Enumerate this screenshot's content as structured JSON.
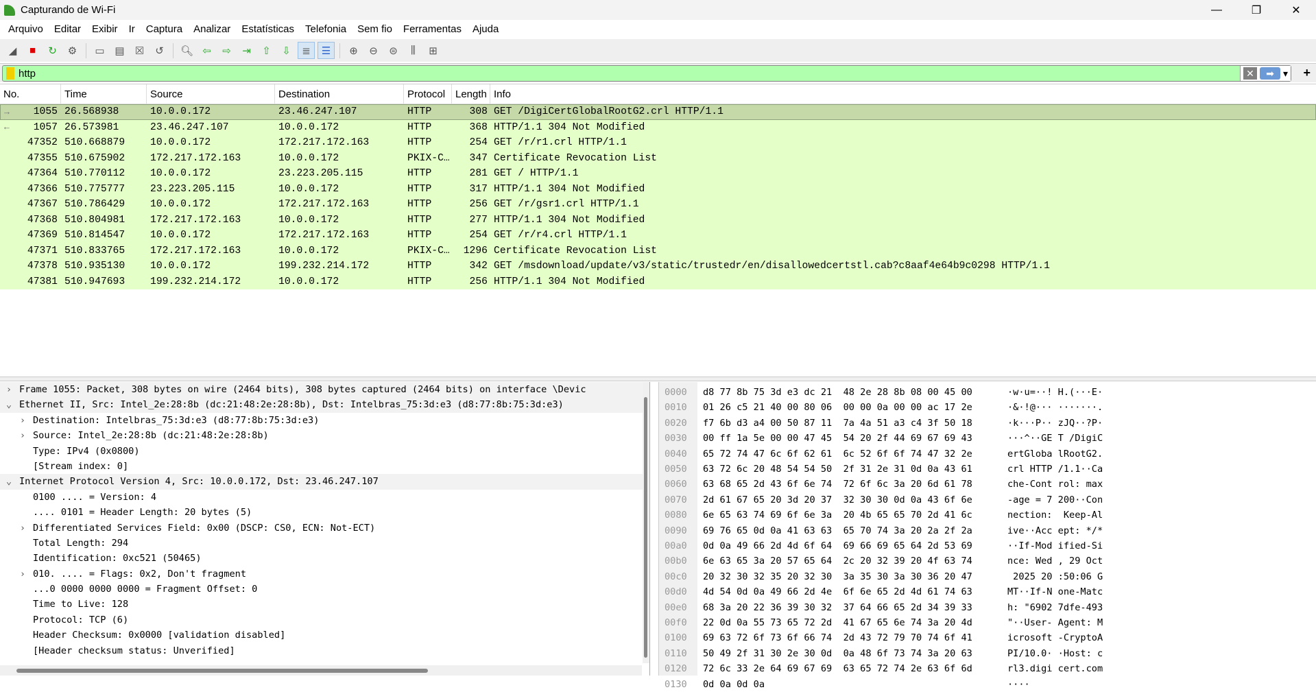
{
  "window": {
    "title": "Capturando de Wi-Fi",
    "minimize": "—",
    "restore": "❐",
    "close": "✕"
  },
  "menu": [
    "Arquivo",
    "Editar",
    "Exibir",
    "Ir",
    "Captura",
    "Analizar",
    "Estatísticas",
    "Telefonia",
    "Sem fio",
    "Ferramentas",
    "Ajuda"
  ],
  "toolbar_icons": [
    "start-capture-icon",
    "stop-capture-icon",
    "restart-capture-icon",
    "capture-options-icon",
    "open-file-icon",
    "save-file-icon",
    "close-file-icon",
    "reload-file-icon",
    "find-packet-icon",
    "go-back-icon",
    "go-forward-icon",
    "go-to-packet-icon",
    "first-packet-icon",
    "last-packet-icon",
    "autoscroll-icon",
    "colorize-icon",
    "zoom-in-icon",
    "zoom-out-icon",
    "normal-size-icon",
    "resize-columns-icon",
    "layout-icon"
  ],
  "filter": {
    "value": "http",
    "clear": "✕",
    "apply": "➡",
    "dropdown": "▾",
    "add": "+"
  },
  "packet_list": {
    "columns": [
      "No.",
      "Time",
      "Source",
      "Destination",
      "Protocol",
      "Length",
      "Info"
    ],
    "rows": [
      {
        "no": "1055",
        "time": "26.568938",
        "src": "10.0.0.172",
        "dst": "23.46.247.107",
        "proto": "HTTP",
        "len": "308",
        "info": "GET /DigiCertGlobalRootG2.crl HTTP/1.1",
        "selected": true,
        "mark": "→"
      },
      {
        "no": "1057",
        "time": "26.573981",
        "src": "23.46.247.107",
        "dst": "10.0.0.172",
        "proto": "HTTP",
        "len": "368",
        "info": "HTTP/1.1 304 Not Modified",
        "mark": "←"
      },
      {
        "no": "47352",
        "time": "510.668879",
        "src": "10.0.0.172",
        "dst": "172.217.172.163",
        "proto": "HTTP",
        "len": "254",
        "info": "GET /r/r1.crl HTTP/1.1"
      },
      {
        "no": "47355",
        "time": "510.675902",
        "src": "172.217.172.163",
        "dst": "10.0.0.172",
        "proto": "PKIX-C…",
        "len": "347",
        "info": "Certificate Revocation List"
      },
      {
        "no": "47364",
        "time": "510.770112",
        "src": "10.0.0.172",
        "dst": "23.223.205.115",
        "proto": "HTTP",
        "len": "281",
        "info": "GET / HTTP/1.1"
      },
      {
        "no": "47366",
        "time": "510.775777",
        "src": "23.223.205.115",
        "dst": "10.0.0.172",
        "proto": "HTTP",
        "len": "317",
        "info": "HTTP/1.1 304 Not Modified"
      },
      {
        "no": "47367",
        "time": "510.786429",
        "src": "10.0.0.172",
        "dst": "172.217.172.163",
        "proto": "HTTP",
        "len": "256",
        "info": "GET /r/gsr1.crl HTTP/1.1"
      },
      {
        "no": "47368",
        "time": "510.804981",
        "src": "172.217.172.163",
        "dst": "10.0.0.172",
        "proto": "HTTP",
        "len": "277",
        "info": "HTTP/1.1 304 Not Modified"
      },
      {
        "no": "47369",
        "time": "510.814547",
        "src": "10.0.0.172",
        "dst": "172.217.172.163",
        "proto": "HTTP",
        "len": "254",
        "info": "GET /r/r4.crl HTTP/1.1"
      },
      {
        "no": "47371",
        "time": "510.833765",
        "src": "172.217.172.163",
        "dst": "10.0.0.172",
        "proto": "PKIX-C…",
        "len": "1296",
        "info": "Certificate Revocation List"
      },
      {
        "no": "47378",
        "time": "510.935130",
        "src": "10.0.0.172",
        "dst": "199.232.214.172",
        "proto": "HTTP",
        "len": "342",
        "info": "GET /msdownload/update/v3/static/trustedr/en/disallowedcertstl.cab?c8aaf4e64b9c0298 HTTP/1.1"
      },
      {
        "no": "47381",
        "time": "510.947693",
        "src": "199.232.214.172",
        "dst": "10.0.0.172",
        "proto": "HTTP",
        "len": "256",
        "info": "HTTP/1.1 304 Not Modified"
      }
    ]
  },
  "details": [
    {
      "level": 0,
      "exp": ">",
      "text": "Frame 1055: Packet, 308 bytes on wire (2464 bits), 308 bytes captured (2464 bits) on interface \\Devic"
    },
    {
      "level": 0,
      "exp": "v",
      "text": "Ethernet II, Src: Intel_2e:28:8b (dc:21:48:2e:28:8b), Dst: Intelbras_75:3d:e3 (d8:77:8b:75:3d:e3)"
    },
    {
      "level": 1,
      "exp": ">",
      "text": "Destination: Intelbras_75:3d:e3 (d8:77:8b:75:3d:e3)"
    },
    {
      "level": 1,
      "exp": ">",
      "text": "Source: Intel_2e:28:8b (dc:21:48:2e:28:8b)"
    },
    {
      "level": 1,
      "exp": "",
      "text": "Type: IPv4 (0x0800)"
    },
    {
      "level": 1,
      "exp": "",
      "text": "[Stream index: 0]"
    },
    {
      "level": 0,
      "exp": "v",
      "text": "Internet Protocol Version 4, Src: 10.0.0.172, Dst: 23.46.247.107"
    },
    {
      "level": 1,
      "exp": "",
      "text": "0100 .... = Version: 4"
    },
    {
      "level": 1,
      "exp": "",
      "text": ".... 0101 = Header Length: 20 bytes (5)"
    },
    {
      "level": 1,
      "exp": ">",
      "text": "Differentiated Services Field: 0x00 (DSCP: CS0, ECN: Not-ECT)"
    },
    {
      "level": 1,
      "exp": "",
      "text": "Total Length: 294"
    },
    {
      "level": 1,
      "exp": "",
      "text": "Identification: 0xc521 (50465)"
    },
    {
      "level": 1,
      "exp": ">",
      "text": "010. .... = Flags: 0x2, Don't fragment"
    },
    {
      "level": 1,
      "exp": "",
      "text": "...0 0000 0000 0000 = Fragment Offset: 0"
    },
    {
      "level": 1,
      "exp": "",
      "text": "Time to Live: 128"
    },
    {
      "level": 1,
      "exp": "",
      "text": "Protocol: TCP (6)"
    },
    {
      "level": 1,
      "exp": "",
      "text": "Header Checksum: 0x0000 [validation disabled]"
    },
    {
      "level": 1,
      "exp": "",
      "text": "[Header checksum status: Unverified]"
    }
  ],
  "bytes": [
    [
      "0000",
      "d8 77 8b 75 3d e3 dc 21  48 2e 28 8b 08 00 45 00",
      "·w·u=··! H.(···E·"
    ],
    [
      "0010",
      "01 26 c5 21 40 00 80 06  00 00 0a 00 00 ac 17 2e",
      "·&·!@··· ·······."
    ],
    [
      "0020",
      "f7 6b d3 a4 00 50 87 11  7a 4a 51 a3 c4 3f 50 18",
      "·k···P·· zJQ··?P·"
    ],
    [
      "0030",
      "00 ff 1a 5e 00 00 47 45  54 20 2f 44 69 67 69 43",
      "···^··GE T /DigiC"
    ],
    [
      "0040",
      "65 72 74 47 6c 6f 62 61  6c 52 6f 6f 74 47 32 2e",
      "ertGloba lRootG2."
    ],
    [
      "0050",
      "63 72 6c 20 48 54 54 50  2f 31 2e 31 0d 0a 43 61",
      "crl HTTP /1.1··Ca"
    ],
    [
      "0060",
      "63 68 65 2d 43 6f 6e 74  72 6f 6c 3a 20 6d 61 78",
      "che-Cont rol: max"
    ],
    [
      "0070",
      "2d 61 67 65 20 3d 20 37  32 30 30 0d 0a 43 6f 6e",
      "-age = 7 200··Con"
    ],
    [
      "0080",
      "6e 65 63 74 69 6f 6e 3a  20 4b 65 65 70 2d 41 6c",
      "nection:  Keep-Al"
    ],
    [
      "0090",
      "69 76 65 0d 0a 41 63 63  65 70 74 3a 20 2a 2f 2a",
      "ive··Acc ept: */*"
    ],
    [
      "00a0",
      "0d 0a 49 66 2d 4d 6f 64  69 66 69 65 64 2d 53 69",
      "··If-Mod ified-Si"
    ],
    [
      "00b0",
      "6e 63 65 3a 20 57 65 64  2c 20 32 39 20 4f 63 74",
      "nce: Wed , 29 Oct"
    ],
    [
      "00c0",
      "20 32 30 32 35 20 32 30  3a 35 30 3a 30 36 20 47",
      " 2025 20 :50:06 G"
    ],
    [
      "00d0",
      "4d 54 0d 0a 49 66 2d 4e  6f 6e 65 2d 4d 61 74 63",
      "MT··If-N one-Matc"
    ],
    [
      "00e0",
      "68 3a 20 22 36 39 30 32  37 64 66 65 2d 34 39 33",
      "h: \"6902 7dfe-493"
    ],
    [
      "00f0",
      "22 0d 0a 55 73 65 72 2d  41 67 65 6e 74 3a 20 4d",
      "\"··User- Agent: M"
    ],
    [
      "0100",
      "69 63 72 6f 73 6f 66 74  2d 43 72 79 70 74 6f 41",
      "icrosoft -CryptoA"
    ],
    [
      "0110",
      "50 49 2f 31 30 2e 30 0d  0a 48 6f 73 74 3a 20 63",
      "PI/10.0· ·Host: c"
    ],
    [
      "0120",
      "72 6c 33 2e 64 69 67 69  63 65 72 74 2e 63 6f 6d",
      "rl3.digi cert.com"
    ],
    [
      "0130",
      "0d 0a 0d 0a",
      "····"
    ]
  ],
  "colors": {
    "row_bg": "#e4ffc7",
    "row_selected": "#c5d9a8",
    "filter_bg": "#afffaf"
  }
}
